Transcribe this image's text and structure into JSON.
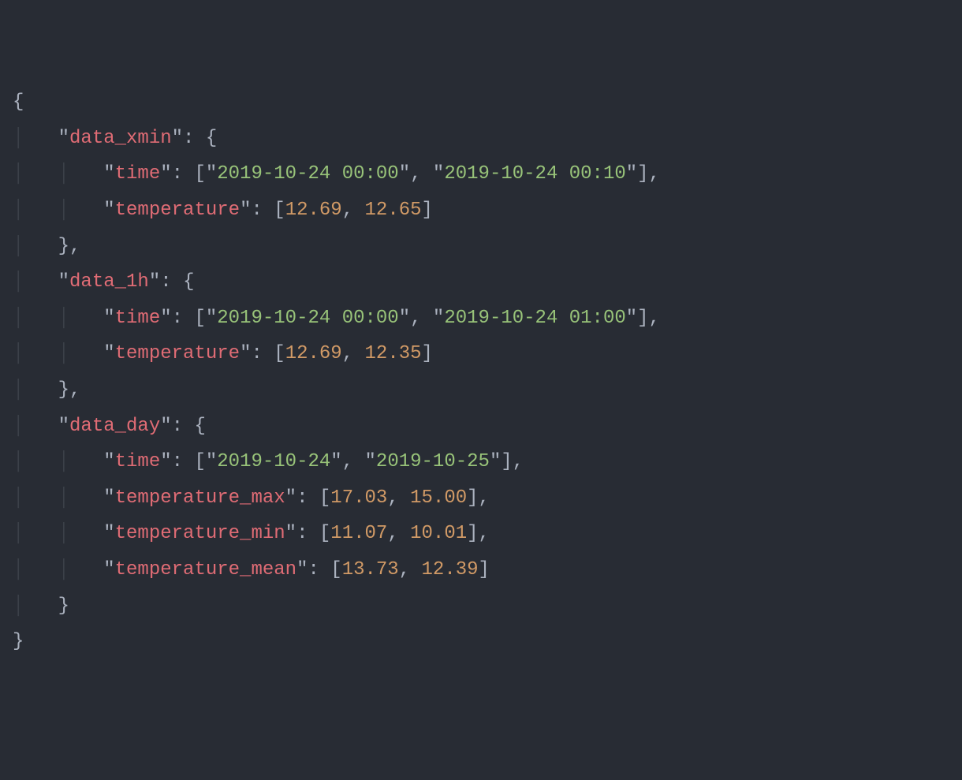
{
  "code": {
    "indent1": "    ",
    "indent2": "        ",
    "brace_open": "{",
    "brace_close": "}",
    "bracket_open": "[",
    "bracket_close": "]",
    "colon_sp": ": ",
    "comma": ",",
    "comma_sp": ", ",
    "quote": "\"",
    "guide1": "│   ",
    "guide2": "│   │   ",
    "data_xmin": {
      "label": "data_xmin",
      "time_label": "time",
      "time": [
        "2019-10-24 00:00",
        "2019-10-24 00:10"
      ],
      "temperature_label": "temperature",
      "temperature": [
        "12.69",
        "12.65"
      ]
    },
    "data_1h": {
      "label": "data_1h",
      "time_label": "time",
      "time": [
        "2019-10-24 00:00",
        "2019-10-24 01:00"
      ],
      "temperature_label": "temperature",
      "temperature": [
        "12.69",
        "12.35"
      ]
    },
    "data_day": {
      "label": "data_day",
      "time_label": "time",
      "time": [
        "2019-10-24",
        "2019-10-25"
      ],
      "temperature_max_label": "temperature_max",
      "temperature_max": [
        "17.03",
        "15.00"
      ],
      "temperature_min_label": "temperature_min",
      "temperature_min": [
        "11.07",
        "10.01"
      ],
      "temperature_mean_label": "temperature_mean",
      "temperature_mean": [
        "13.73",
        "12.39"
      ]
    }
  }
}
